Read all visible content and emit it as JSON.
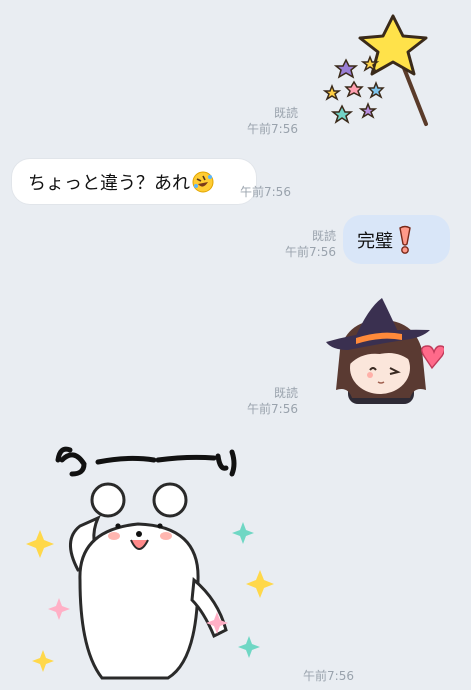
{
  "messages": [
    {
      "type": "sticker",
      "sticker": "star-wand-sticker",
      "read": "既読",
      "time": "午前7:56"
    },
    {
      "type": "incoming-text",
      "text": "ちょっと違う？あれ",
      "emoji": "rofl-emoji",
      "time": "午前7:56"
    },
    {
      "type": "outgoing-text",
      "text": "完璧",
      "emoji": "exclamation-emoji",
      "read": "既読",
      "time": "午前7:56"
    },
    {
      "type": "sticker",
      "sticker": "witch-girl-sticker",
      "read": "既読",
      "time": "午前7:56"
    },
    {
      "type": "sticker",
      "sticker": "bear-waai-sticker",
      "sticker_text": "わーーい",
      "time": "午前7:56"
    }
  ]
}
